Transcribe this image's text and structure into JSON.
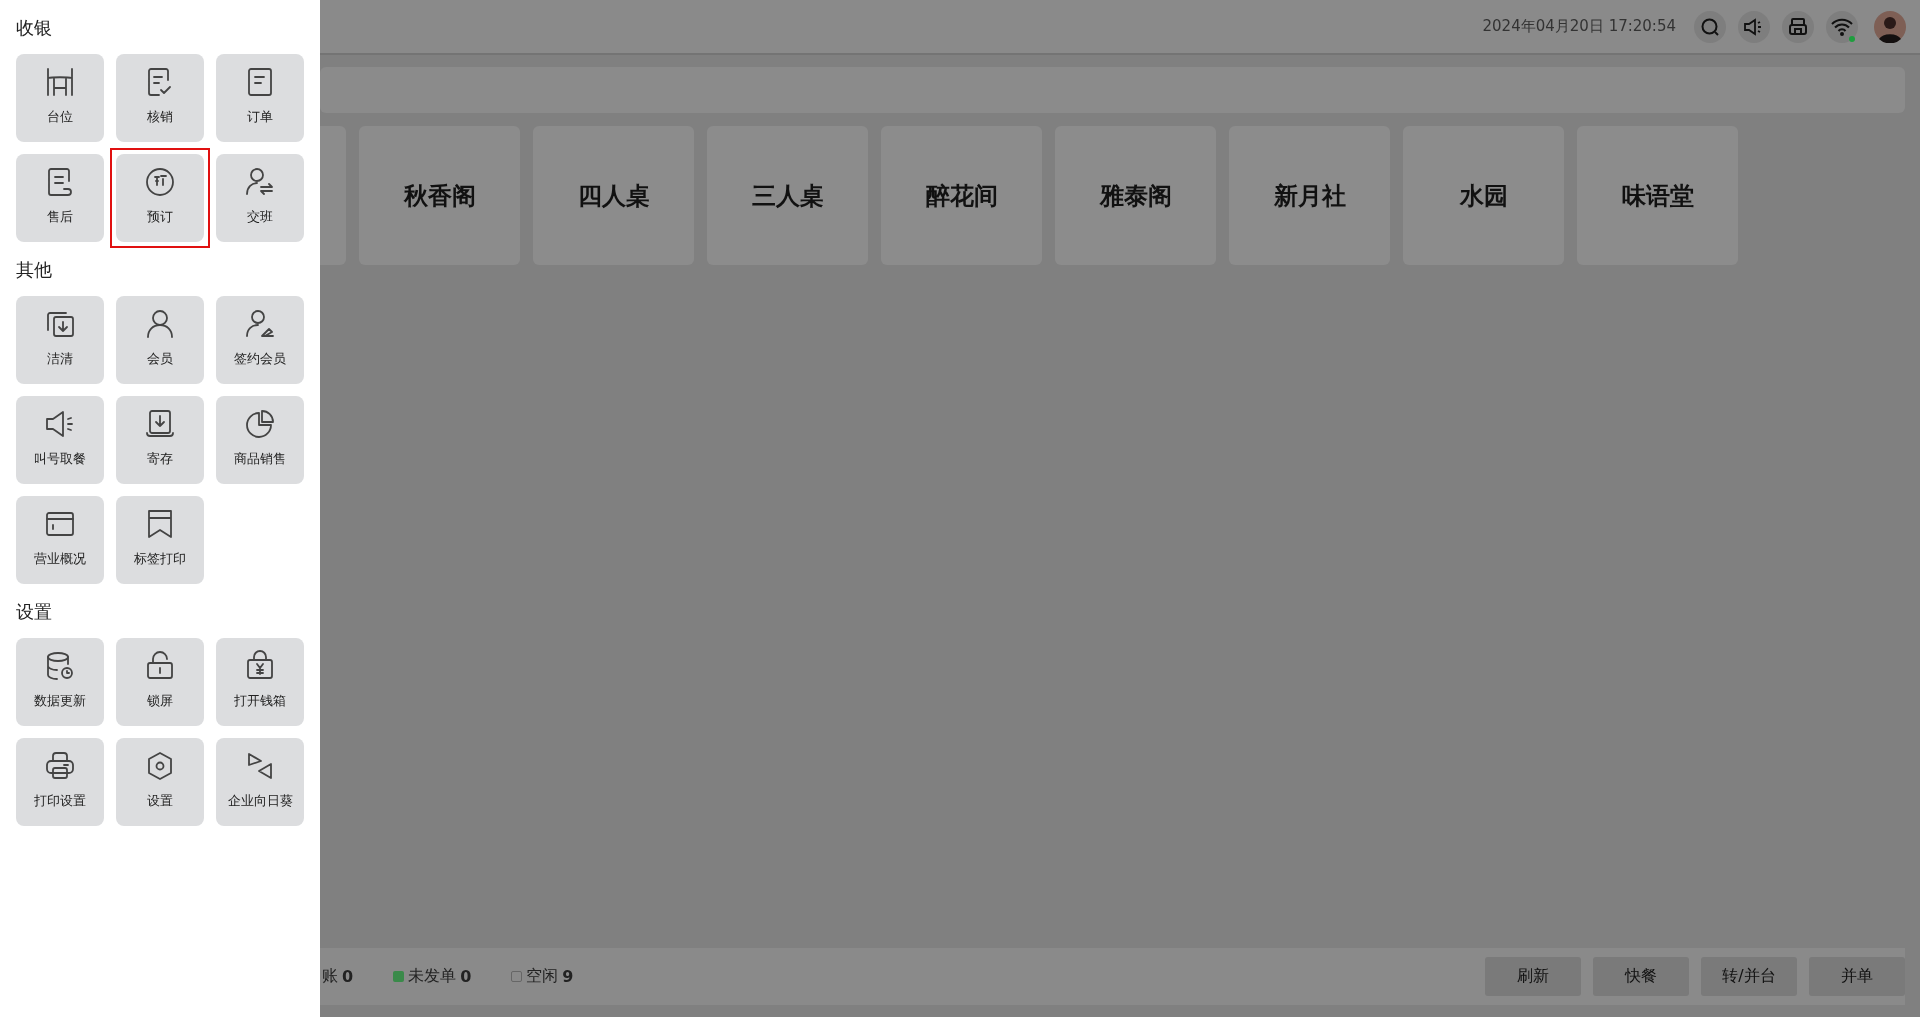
{
  "sidebar": {
    "sections": [
      {
        "title": "收银",
        "items": [
          {
            "label": "台位",
            "selected": false
          },
          {
            "label": "核销",
            "selected": false
          },
          {
            "label": "订单",
            "selected": false
          },
          {
            "label": "售后",
            "selected": false
          },
          {
            "label": "预订",
            "selected": true
          },
          {
            "label": "交班",
            "selected": false
          }
        ]
      },
      {
        "title": "其他",
        "items": [
          {
            "label": "洁清",
            "selected": false
          },
          {
            "label": "会员",
            "selected": false
          },
          {
            "label": "签约会员",
            "selected": false
          },
          {
            "label": "叫号取餐",
            "selected": false
          },
          {
            "label": "寄存",
            "selected": false
          },
          {
            "label": "商品销售",
            "selected": false
          },
          {
            "label": "营业概况",
            "selected": false
          },
          {
            "label": "标签打印",
            "selected": false
          }
        ]
      },
      {
        "title": "设置",
        "items": [
          {
            "label": "数据更新",
            "selected": false
          },
          {
            "label": "锁屏",
            "selected": false
          },
          {
            "label": "打开钱箱",
            "selected": false
          },
          {
            "label": "打印设置",
            "selected": false
          },
          {
            "label": "设置",
            "selected": false
          },
          {
            "label": "企业向日葵",
            "selected": false
          }
        ]
      }
    ]
  },
  "header": {
    "datetime": "2024年04月20日 17:20:54",
    "wifi_connected": true
  },
  "tables": [
    {
      "name": "秋香阁"
    },
    {
      "name": "四人桌"
    },
    {
      "name": "三人桌"
    },
    {
      "name": "醉花间"
    },
    {
      "name": "雅泰阁"
    },
    {
      "name": "新月社"
    },
    {
      "name": "水园"
    },
    {
      "name": "味语堂"
    }
  ],
  "status_bar": {
    "legend": [
      {
        "label": "账",
        "count": "0",
        "kind": "plain"
      },
      {
        "label": "未发单",
        "count": "0",
        "kind": "dot",
        "color": "#3a8a4a"
      },
      {
        "label": "空闲",
        "count": "9",
        "kind": "square"
      }
    ],
    "buttons": [
      "刷新",
      "快餐",
      "转/并台",
      "并单"
    ]
  }
}
